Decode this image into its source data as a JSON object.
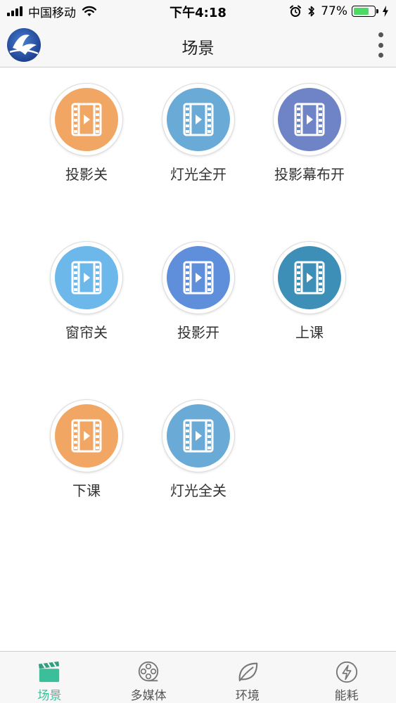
{
  "status_bar": {
    "carrier": "中国移动",
    "time": "下午4:18",
    "battery_percent": "77%",
    "battery_level": 0.77
  },
  "header": {
    "title": "场景"
  },
  "scenes": [
    {
      "label": "投影关",
      "color": "#f2a664"
    },
    {
      "label": "灯光全开",
      "color": "#6aaad6"
    },
    {
      "label": "投影幕布开",
      "color": "#6f84c7"
    },
    {
      "label": "窗帘关",
      "color": "#6db8ea"
    },
    {
      "label": "投影开",
      "color": "#5f8fdb"
    },
    {
      "label": "上课",
      "color": "#3e8fb8"
    },
    {
      "label": "下课",
      "color": "#f2a664"
    },
    {
      "label": "灯光全关",
      "color": "#6aaad6"
    }
  ],
  "tabs": [
    {
      "label": "场景",
      "icon": "clapperboard-icon",
      "active": true
    },
    {
      "label": "多媒体",
      "icon": "film-reel-icon",
      "active": false
    },
    {
      "label": "环境",
      "icon": "leaf-icon",
      "active": false
    },
    {
      "label": "能耗",
      "icon": "lightning-icon",
      "active": false
    }
  ],
  "colors": {
    "accent": "#3bbf9a",
    "bar_background": "#f7f7f7"
  }
}
